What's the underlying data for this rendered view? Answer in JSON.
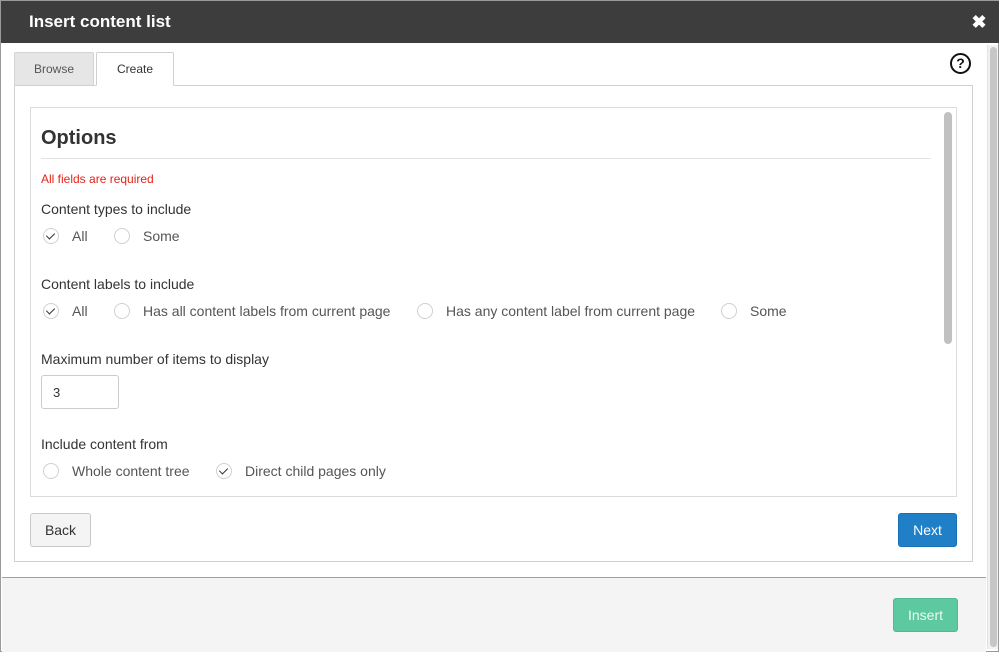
{
  "dialog": {
    "title": "Insert content list",
    "close_symbol": "✖",
    "help_symbol": "?"
  },
  "tabs": [
    {
      "label": "Browse",
      "selected": false
    },
    {
      "label": "Create",
      "selected": true
    }
  ],
  "options": {
    "heading": "Options",
    "required_note": "All fields are required",
    "content_types": {
      "label": "Content types to include",
      "choices": [
        {
          "label": "All",
          "checked": true
        },
        {
          "label": "Some",
          "checked": false
        }
      ]
    },
    "content_labels": {
      "label": "Content labels to include",
      "choices": [
        {
          "label": "All",
          "checked": true
        },
        {
          "label": "Has all content labels from current page",
          "checked": false
        },
        {
          "label": "Has any content label from current page",
          "checked": false
        },
        {
          "label": "Some",
          "checked": false
        }
      ]
    },
    "max_items": {
      "label": "Maximum number of items to display",
      "value": "3"
    },
    "include_from": {
      "label": "Include content from",
      "choices": [
        {
          "label": "Whole content tree",
          "checked": false
        },
        {
          "label": "Direct child pages only",
          "checked": true
        }
      ]
    }
  },
  "buttons": {
    "back": "Back",
    "next": "Next",
    "insert": "Insert"
  },
  "colors": {
    "titlebar": "#3d3d3d",
    "required": "#e2231a",
    "next_button": "#1f7fc7",
    "insert_button": "#5cc9a0"
  },
  "icons": {
    "close": "close-icon",
    "help": "help-icon",
    "check": "check-icon"
  }
}
